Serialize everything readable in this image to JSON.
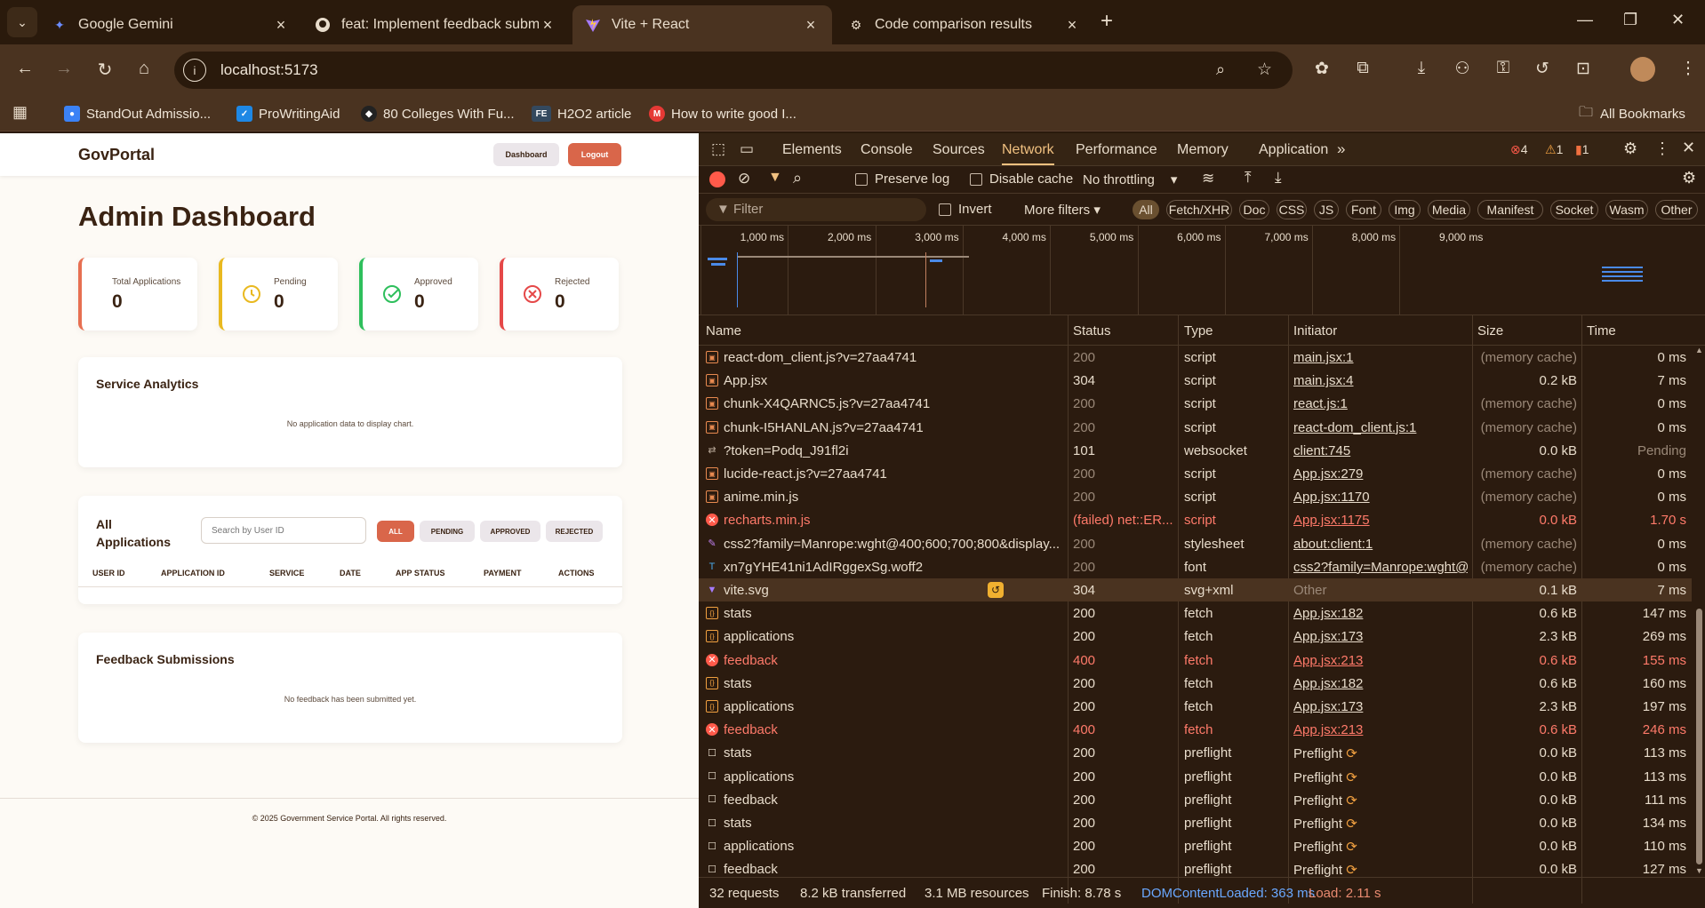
{
  "tabs": [
    {
      "title": "Google Gemini",
      "icon": "gemini-icon"
    },
    {
      "title": "feat: Implement feedback subm",
      "icon": "github-icon"
    },
    {
      "title": "Vite + React",
      "icon": "vite-icon"
    },
    {
      "title": "Code comparison results",
      "icon": "chatgpt-icon"
    }
  ],
  "address": {
    "url": "localhost:5173"
  },
  "bookmarks": [
    {
      "label": "StandOut Admissio...",
      "icon": "person-icon",
      "color": "#3b82f6"
    },
    {
      "label": "ProWritingAid",
      "icon": "prowritingaid-icon",
      "color": "#1e88e5"
    },
    {
      "label": "80 Colleges With Fu...",
      "icon": "college-icon",
      "color": "#222222"
    },
    {
      "label": "H2O2 article",
      "icon": "fe-icon",
      "color": "#34495e",
      "badge": "FE"
    },
    {
      "label": "How to write good I...",
      "icon": "medium-icon",
      "color": "#e53935"
    }
  ],
  "all_bookmarks": "All Bookmarks",
  "app": {
    "brand": "GovPortal",
    "dashboard_btn": "Dashboard",
    "logout_btn": "Logout",
    "title": "Admin Dashboard",
    "stats": [
      {
        "label": "Total Applications",
        "value": "0",
        "color": "#e76f51"
      },
      {
        "label": "Pending",
        "value": "0",
        "color": "#e9b920"
      },
      {
        "label": "Approved",
        "value": "0",
        "color": "#2ebf5c"
      },
      {
        "label": "Rejected",
        "value": "0",
        "color": "#e54848"
      }
    ],
    "analytics_title": "Service Analytics",
    "analytics_empty": "No application data to display chart.",
    "apps_title_1": "All",
    "apps_title_2": "Applications",
    "search_placeholder": "Search by User ID",
    "filters": [
      "ALL",
      "PENDING",
      "APPROVED",
      "REJECTED"
    ],
    "columns": [
      "USER ID",
      "APPLICATION ID",
      "SERVICE",
      "DATE",
      "APP STATUS",
      "PAYMENT",
      "ACTIONS"
    ],
    "feedback_title": "Feedback Submissions",
    "feedback_empty": "No feedback has been submitted yet.",
    "footer": "© 2025 Government Service Portal. All rights reserved."
  },
  "devtools": {
    "tabs": [
      "Elements",
      "Console",
      "Sources",
      "Network",
      "Performance",
      "Memory",
      "Application"
    ],
    "active_tab": "Network",
    "errors": "4",
    "warnings": "1",
    "issues": "1",
    "preserve_log": "Preserve log",
    "disable_cache": "Disable cache",
    "throttling": "No throttling",
    "filter_placeholder": "Filter",
    "invert": "Invert",
    "more_filters": "More filters",
    "type_filters": [
      "All",
      "Fetch/XHR",
      "Doc",
      "CSS",
      "JS",
      "Font",
      "Img",
      "Media",
      "Manifest",
      "Socket",
      "Wasm",
      "Other"
    ],
    "ticks": [
      "1,000 ms",
      "2,000 ms",
      "3,000 ms",
      "4,000 ms",
      "5,000 ms",
      "6,000 ms",
      "7,000 ms",
      "8,000 ms",
      "9,000 ms"
    ],
    "columns": [
      "Name",
      "Status",
      "Type",
      "Initiator",
      "Size",
      "Time"
    ],
    "requests": [
      {
        "name": "react-dom_client.js?v=27aa4741",
        "status": "200",
        "type": "script",
        "initiator": "main.jsx:1",
        "size": "(memory cache)",
        "time": "0 ms",
        "kind": "script"
      },
      {
        "name": "App.jsx",
        "status": "304",
        "type": "script",
        "initiator": "main.jsx:4",
        "size": "0.2 kB",
        "time": "7 ms",
        "kind": "script"
      },
      {
        "name": "chunk-X4QARNC5.js?v=27aa4741",
        "status": "200",
        "type": "script",
        "initiator": "react.js:1",
        "size": "(memory cache)",
        "time": "0 ms",
        "kind": "script"
      },
      {
        "name": "chunk-I5HANLAN.js?v=27aa4741",
        "status": "200",
        "type": "script",
        "initiator": "react-dom_client.js:1",
        "size": "(memory cache)",
        "time": "0 ms",
        "kind": "script"
      },
      {
        "name": "?token=Podq_J91fl2i",
        "status": "101",
        "type": "websocket",
        "initiator": "client:745",
        "size": "0.0 kB",
        "time": "Pending",
        "kind": "ws"
      },
      {
        "name": "lucide-react.js?v=27aa4741",
        "status": "200",
        "type": "script",
        "initiator": "App.jsx:279",
        "size": "(memory cache)",
        "time": "0 ms",
        "kind": "script"
      },
      {
        "name": "anime.min.js",
        "status": "200",
        "type": "script",
        "initiator": "App.jsx:1170",
        "size": "(memory cache)",
        "time": "0 ms",
        "kind": "script"
      },
      {
        "name": "recharts.min.js",
        "status": "(failed) net::ER...",
        "type": "script",
        "initiator": "App.jsx:1175",
        "size": "0.0 kB",
        "time": "1.70 s",
        "kind": "error"
      },
      {
        "name": "css2?family=Manrope:wght@400;600;700;800&display...",
        "status": "200",
        "type": "stylesheet",
        "initiator": "about:client:1",
        "size": "(memory cache)",
        "time": "0 ms",
        "kind": "css"
      },
      {
        "name": "xn7gYHE41ni1AdIRggexSg.woff2",
        "status": "200",
        "type": "font",
        "initiator": "css2?family=Manrope:wght@4",
        "size": "(memory cache)",
        "time": "0 ms",
        "kind": "font"
      },
      {
        "name": "vite.svg",
        "status": "304",
        "type": "svg+xml",
        "initiator": "Other",
        "size": "0.1 kB",
        "time": "7 ms",
        "kind": "img"
      },
      {
        "name": "stats",
        "status": "200",
        "type": "fetch",
        "initiator": "App.jsx:182",
        "size": "0.6 kB",
        "time": "147 ms",
        "kind": "fetch"
      },
      {
        "name": "applications",
        "status": "200",
        "type": "fetch",
        "initiator": "App.jsx:173",
        "size": "2.3 kB",
        "time": "269 ms",
        "kind": "fetch"
      },
      {
        "name": "feedback",
        "status": "400",
        "type": "fetch",
        "initiator": "App.jsx:213",
        "size": "0.6 kB",
        "time": "155 ms",
        "kind": "error"
      },
      {
        "name": "stats",
        "status": "200",
        "type": "fetch",
        "initiator": "App.jsx:182",
        "size": "0.6 kB",
        "time": "160 ms",
        "kind": "fetch"
      },
      {
        "name": "applications",
        "status": "200",
        "type": "fetch",
        "initiator": "App.jsx:173",
        "size": "2.3 kB",
        "time": "197 ms",
        "kind": "fetch"
      },
      {
        "name": "feedback",
        "status": "400",
        "type": "fetch",
        "initiator": "App.jsx:213",
        "size": "0.6 kB",
        "time": "246 ms",
        "kind": "error"
      },
      {
        "name": "stats",
        "status": "200",
        "type": "preflight",
        "initiator": "Preflight",
        "size": "0.0 kB",
        "time": "113 ms",
        "kind": "preflight"
      },
      {
        "name": "applications",
        "status": "200",
        "type": "preflight",
        "initiator": "Preflight",
        "size": "0.0 kB",
        "time": "113 ms",
        "kind": "preflight"
      },
      {
        "name": "feedback",
        "status": "200",
        "type": "preflight",
        "initiator": "Preflight",
        "size": "0.0 kB",
        "time": "111 ms",
        "kind": "preflight"
      },
      {
        "name": "stats",
        "status": "200",
        "type": "preflight",
        "initiator": "Preflight",
        "size": "0.0 kB",
        "time": "134 ms",
        "kind": "preflight"
      },
      {
        "name": "applications",
        "status": "200",
        "type": "preflight",
        "initiator": "Preflight",
        "size": "0.0 kB",
        "time": "110 ms",
        "kind": "preflight"
      },
      {
        "name": "feedback",
        "status": "200",
        "type": "preflight",
        "initiator": "Preflight",
        "size": "0.0 kB",
        "time": "127 ms",
        "kind": "preflight"
      }
    ],
    "selected_row": "vite.svg",
    "status": {
      "requests": "32 requests",
      "transferred": "8.2 kB transferred",
      "resources": "3.1 MB resources",
      "finish": "Finish: 8.78 s",
      "dcl": "DOMContentLoaded: 363 ms",
      "load": "Load: 2.11 s"
    }
  }
}
